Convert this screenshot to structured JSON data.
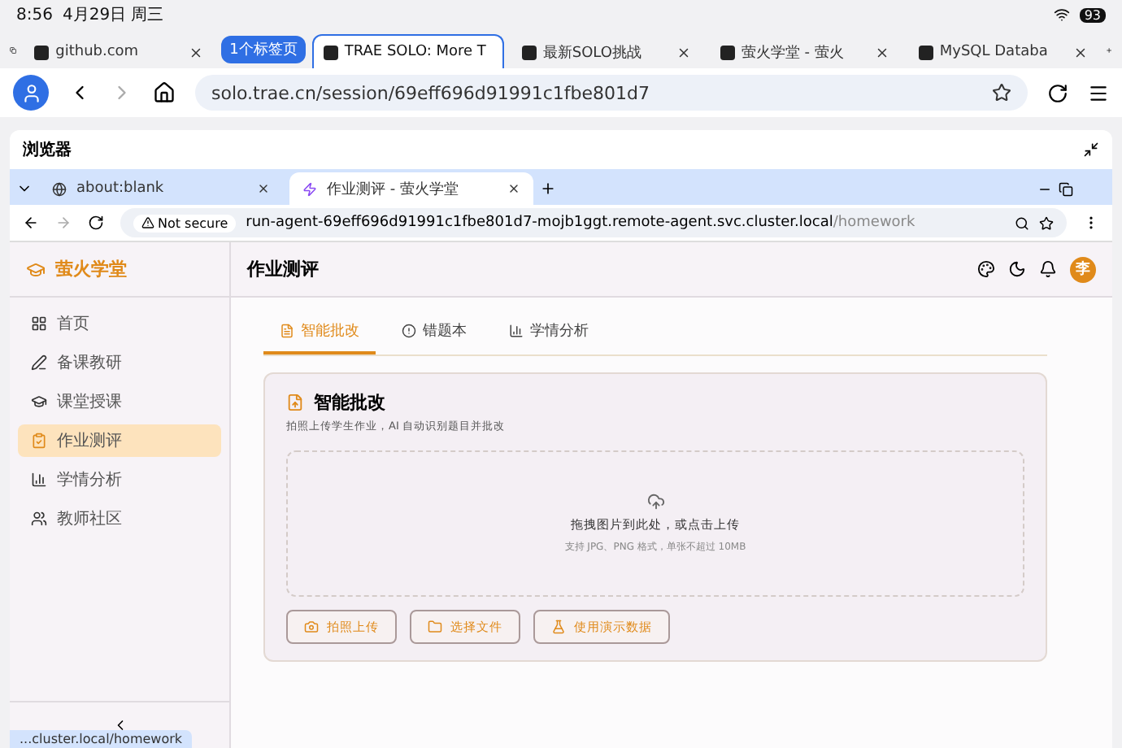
{
  "status_bar": {
    "time": "8:56",
    "date": "4月29日 周三",
    "battery": "93"
  },
  "outer_tabs": [
    {
      "label": "github.com",
      "selected": false,
      "kind": "tab"
    },
    {
      "label": "1个标签页",
      "kind": "group"
    },
    {
      "label": "TRAE SOLO: More T",
      "selected": true,
      "kind": "tab"
    },
    {
      "label": "最新SOLO挑战",
      "selected": false,
      "kind": "tab"
    },
    {
      "label": "萤火学堂 - 萤火",
      "selected": false,
      "kind": "tab"
    },
    {
      "label": "MySQL Databa",
      "selected": false,
      "kind": "tab"
    }
  ],
  "outer_address": "solo.trae.cn/session/69eff696d91991c1fbe801d7",
  "inner_window": {
    "title": "浏览器",
    "tabs": [
      {
        "label": "about:blank",
        "selected": false
      },
      {
        "label": "作业测评 - 萤火学堂",
        "selected": true
      }
    ],
    "security": "Not secure",
    "url_host": "run-agent-69eff696d91991c1fbe801d7-mojb1ggt.remote-agent.svc.cluster.local",
    "url_path": "/homework",
    "status_link": "...cluster.local/homework"
  },
  "app": {
    "brand": "萤火学堂",
    "header_title": "作业测评",
    "avatar": "李",
    "nav": [
      {
        "label": "首页",
        "selected": false
      },
      {
        "label": "备课教研",
        "selected": false
      },
      {
        "label": "课堂授课",
        "selected": false
      },
      {
        "label": "作业测评",
        "selected": true
      },
      {
        "label": "学情分析",
        "selected": false
      },
      {
        "label": "教师社区",
        "selected": false
      }
    ],
    "tabs": [
      {
        "label": "智能批改",
        "selected": true
      },
      {
        "label": "错题本",
        "selected": false
      },
      {
        "label": "学情分析",
        "selected": false
      }
    ],
    "card": {
      "title": "智能批改",
      "subtitle": "拍照上传学生作业，AI 自动识别题目并批改",
      "drop_text": "拖拽图片到此处，或点击上传",
      "drop_hint": "支持 JPG、PNG 格式，单张不超过 10MB",
      "buttons": [
        "拍照上传",
        "选择文件",
        "使用演示数据"
      ]
    }
  }
}
